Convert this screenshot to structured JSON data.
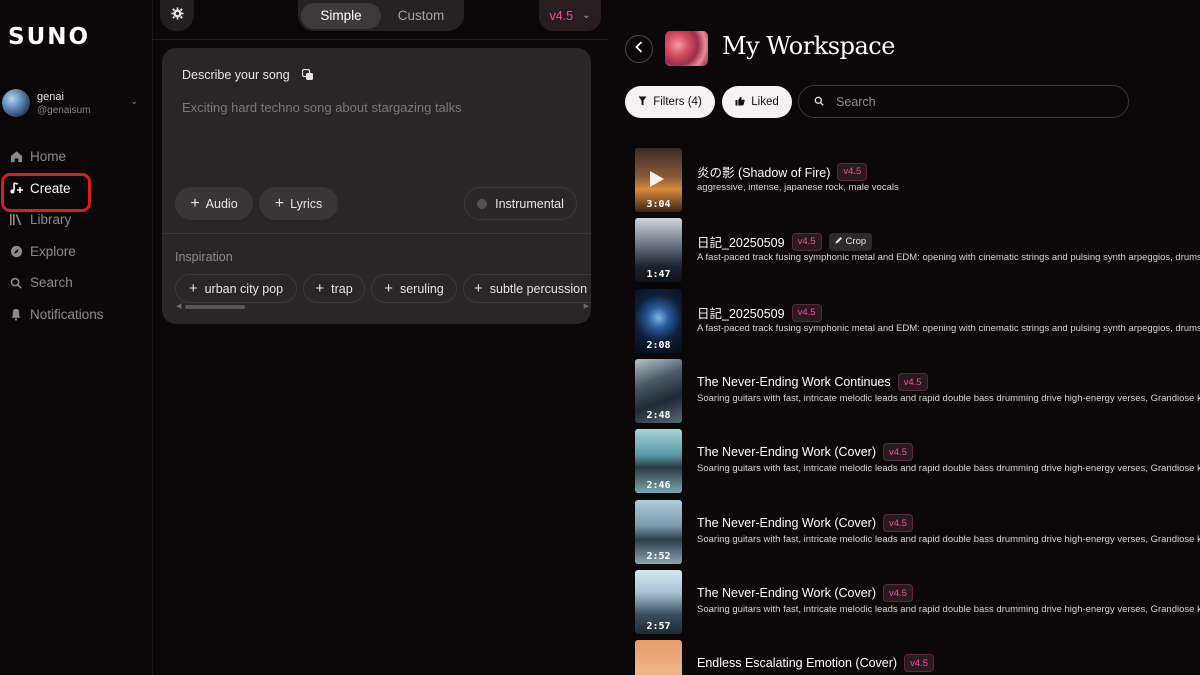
{
  "app": {
    "logo": "SUNO",
    "user": {
      "name": "genai",
      "handle": "@genaisum"
    }
  },
  "sidebar": {
    "items": [
      {
        "label": "Home",
        "icon": "home-icon",
        "active": false
      },
      {
        "label": "Create",
        "icon": "music-note-plus-icon",
        "active": true
      },
      {
        "label": "Library",
        "icon": "library-icon",
        "active": false
      },
      {
        "label": "Explore",
        "icon": "compass-icon",
        "active": false
      },
      {
        "label": "Search",
        "icon": "search-icon",
        "active": false
      },
      {
        "label": "Notifications",
        "icon": "bell-icon",
        "active": false
      }
    ]
  },
  "create": {
    "modes": [
      "Simple",
      "Custom"
    ],
    "selected_mode": "Simple",
    "version": "v4.5",
    "describe_label": "Describe your song",
    "prompt_placeholder": "Exciting hard techno song about stargazing talks",
    "audio_label": "Audio",
    "lyrics_label": "Lyrics",
    "instrumental_label": "Instrumental",
    "inspiration_label": "Inspiration",
    "inspiration_chips": [
      "urban city pop",
      "trap",
      "seruling",
      "subtle percussion"
    ]
  },
  "workspace": {
    "title": "My Workspace",
    "filters_label": "Filters (4)",
    "liked_label": "Liked",
    "search_placeholder": "Search",
    "songs": [
      {
        "title": "炎の影 (Shadow of Fire)",
        "version": "v4.5",
        "crop": "",
        "duration": "3:04",
        "description": "aggressive, intense, japanese rock, male vocals",
        "playing": true
      },
      {
        "title": "日記_20250509",
        "version": "v4.5",
        "crop": "Crop",
        "duration": "1:47",
        "description": "A fast-paced track fusing symphonic metal and EDM: opening with cinematic strings and pulsing synth arpeggios, drums",
        "playing": false
      },
      {
        "title": "日記_20250509",
        "version": "v4.5",
        "crop": "",
        "duration": "2:08",
        "description": "A fast-paced track fusing symphonic metal and EDM: opening with cinematic strings and pulsing synth arpeggios, drums",
        "playing": false
      },
      {
        "title": "The Never-Ending Work Continues",
        "version": "v4.5",
        "crop": "",
        "duration": "2:48",
        "description": "Soaring guitars with fast, intricate melodic leads and rapid double bass drumming drive high-energy verses, Grandiose ke",
        "playing": false
      },
      {
        "title": "The Never-Ending Work (Cover)",
        "version": "v4.5",
        "crop": "",
        "duration": "2:46",
        "description": "Soaring guitars with fast, intricate melodic leads and rapid double bass drumming drive high-energy verses, Grandiose ke",
        "playing": false
      },
      {
        "title": "The Never-Ending Work (Cover)",
        "version": "v4.5",
        "crop": "",
        "duration": "2:52",
        "description": "Soaring guitars with fast, intricate melodic leads and rapid double bass drumming drive high-energy verses, Grandiose ke",
        "playing": false
      },
      {
        "title": "The Never-Ending Work (Cover)",
        "version": "v4.5",
        "crop": "",
        "duration": "2:57",
        "description": "Soaring guitars with fast, intricate melodic leads and rapid double bass drumming drive high-energy verses, Grandiose ke",
        "playing": false
      },
      {
        "title": "Endless Escalating Emotion (Cover)",
        "version": "v4.5",
        "crop": "",
        "duration": "",
        "description": "",
        "playing": false
      }
    ]
  },
  "colors": {
    "accent_pink": "#f04ea4",
    "highlight_red": "#d51d22",
    "background": "#0c0708",
    "card": "#2a2526"
  }
}
